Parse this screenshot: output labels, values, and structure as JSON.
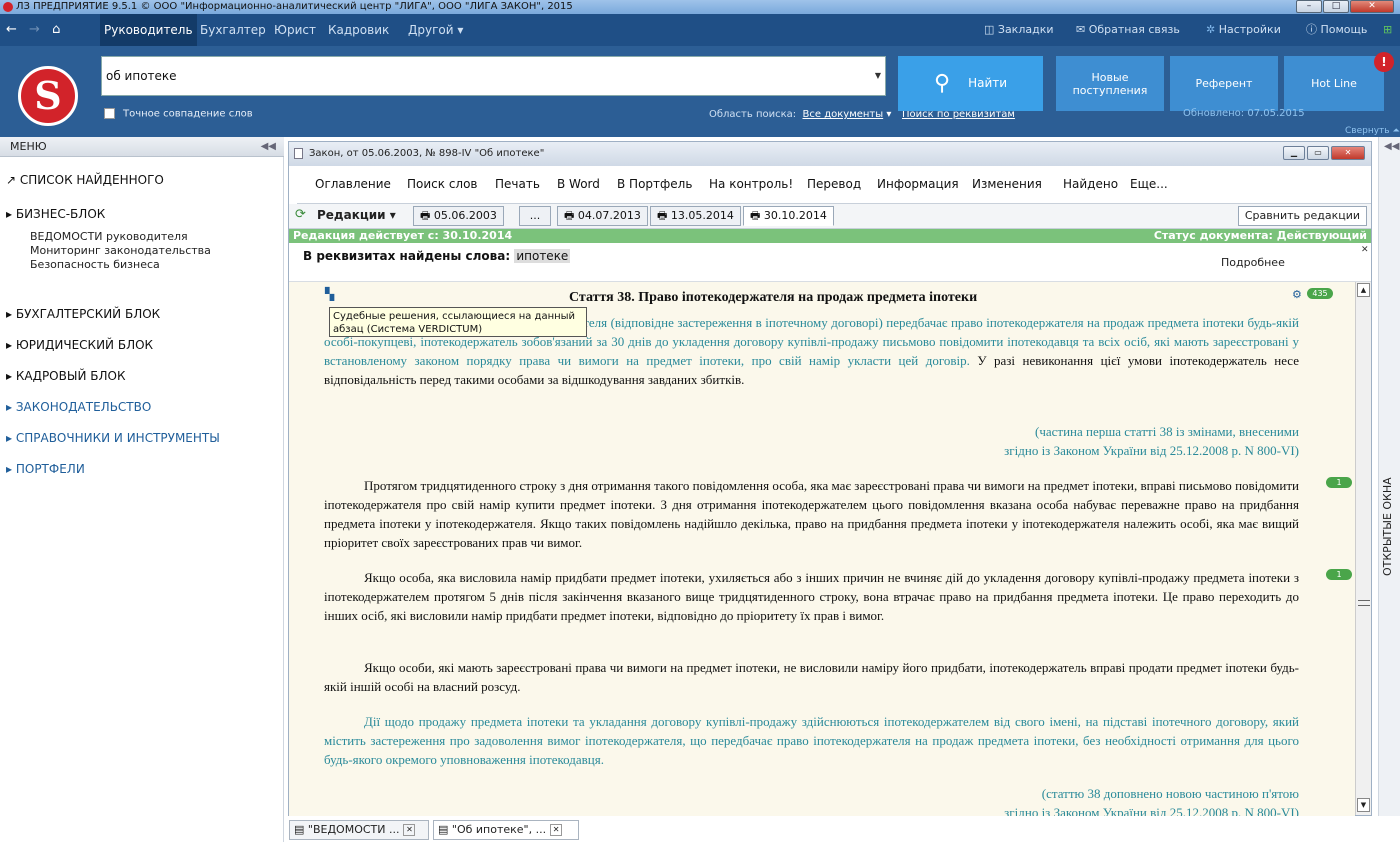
{
  "window": {
    "title": "ЛЗ ПРЕДПРИЯТИЕ 9.5.1 © ООО \"Информационно-аналитический центр \"ЛИГА\", ООО \"ЛИГА ЗАКОН\", 2015",
    "min": "–",
    "max": "□",
    "close": "✕"
  },
  "nav": {
    "back_icon": "←",
    "forward_icon": "→",
    "home_icon": "⌂",
    "tabs": [
      "Руководитель",
      "Бухгалтер",
      "Юрист",
      "Кадровик",
      "Другой ▾"
    ],
    "bookmarks": "Закладки",
    "feedback": "Обратная связь",
    "settings": "Настройки",
    "help": "Помощь"
  },
  "search": {
    "value": "об ипотеке",
    "exact_label": "Точное совпадение слов",
    "scope_label": "Область поиска:",
    "scope_value": "Все документы",
    "by_requisites": "Поиск по реквизитам",
    "find_label": "Найти"
  },
  "header": {
    "new_docs": "Новые поступления",
    "referent": "Референт",
    "hotline": "Hot Line",
    "updated": "Обновлено: 07.05.2015",
    "collapse": "Свернуть",
    "badge": "!"
  },
  "menu": {
    "title": "МЕНЮ",
    "found_list": "СПИСОК НАЙДЕННОГО",
    "business": "БИЗНЕС-БЛОК",
    "business_items": [
      "ВЕДОМОСТИ руководителя",
      "Мониторинг законодательства",
      "Безопасность бизнеса"
    ],
    "accounting": "БУХГАЛТЕРСКИЙ БЛОК",
    "legal": "ЮРИДИЧЕСКИЙ БЛОК",
    "hr": "КАДРОВЫЙ БЛОК",
    "legislation": "ЗАКОНОДАТЕЛЬСТВО",
    "references": "СПРАВОЧНИКИ И ИНСТРУМЕНТЫ",
    "portfolios": "ПОРТФЕЛИ"
  },
  "doc": {
    "title": "Закон, от 05.06.2003, № 898-IV \"Об ипотеке\"",
    "menu": [
      "Оглавление",
      "Поиск слов",
      "Печать",
      "В Word",
      "В Портфель",
      "На контроль!",
      "Перевод",
      "Информация",
      "Изменения",
      "Найдено",
      "Еще..."
    ],
    "revisions_label": "Редакции",
    "revisions": [
      "05.06.2003",
      "...",
      "04.07.2013",
      "13.05.2014",
      "30.10.2014"
    ],
    "compare": "Сравнить редакции",
    "effective": "Редакция действует с: 30.10.2014",
    "status": "Статус документа: Действующий",
    "found_words_label": "В реквизитах найдены слова:",
    "found_word": "ипотеке",
    "details": "Подробнее",
    "article_title": "Стаття 38. Право іпотекодержателя на продаж предмета іпотеки",
    "count_badge": "435",
    "tooltip": "Судебные решения, ссылающиеся на данный абзац (Система VERDICTUM)",
    "p1_teal": "У разі задоволення вимог іпотекодержателя (відповідне застереження в іпотечному договорі) передбачає право іпотекодержателя на продаж предмета іпотеки будь-якій особі-покупцеві, іпотекодержатель зобов'язаний за 30 днів до укладення договору купівлі-продажу письмово повідомити іпотекодавця та всіх осіб, які мають зареєстровані у встановленому законом порядку права чи вимоги на предмет іпотеки, про свій намір укласти цей договір.",
    "p1_black": " У разі невиконання цієї умови іпотекодержатель несе відповідальність перед такими особами за відшкодування завданих збитків.",
    "note1_a": "(частина перша статті 38 із змінами, внесеними",
    "note1_b": "згідно із Законом України від 25.12.2008 р. N 800-VI)",
    "p2": "Протягом тридцятиденного строку з дня отримання такого повідомлення особа, яка має зареєстровані права чи вимоги на предмет іпотеки, вправі письмово повідомити іпотекодержателя про свій намір купити предмет іпотеки. З дня отримання іпотекодержателем цього повідомлення вказана особа набуває переважне право на придбання предмета іпотеки у іпотекодержателя. Якщо таких повідомлень надійшло декілька, право на придбання предмета іпотеки у іпотекодержателя належить особі, яка має вищий пріоритет своїх зареєстрованих прав чи вимог.",
    "p3": "Якщо особа, яка висловила намір придбати предмет іпотеки, ухиляється або з інших причин не вчиняє дій до укладення договору купівлі-продажу предмета іпотеки з іпотекодержателем протягом 5 днів після закінчення вказаного вище тридцятиденного строку, вона втрачає право на придбання предмета іпотеки. Це право переходить до інших осіб, які висловили намір придбати предмет іпотеки, відповідно до пріоритету їх прав і вимог.",
    "p4": "Якщо особи, які мають зареєстровані права чи вимоги на предмет іпотеки, не висловили наміру його придбати, іпотекодержатель вправі продати предмет іпотеки будь-якій іншій особі на власний розсуд.",
    "p5": "Дії щодо продажу предмета іпотеки та укладання договору купівлі-продажу здійснюються іпотекодержателем від свого імені, на підставі іпотечного договору, який містить застереження про задоволення вимог іпотекодержателя, що передбачає право іпотекодержателя на продаж предмета іпотеки, без необхідності отримання для цього будь-якого окремого уповноваження іпотекодавця.",
    "note2_a": "(статтю 38 доповнено новою частиною п'ятою",
    "note2_b": "згідно із Законом України від 25.12.2008 р. N 800-VI)",
    "pill": "1"
  },
  "bottom_tabs": [
    "\"ВЕДОМОСТИ ...",
    "\"Об ипотеке\", ..."
  ],
  "right_strip": "ОТКРЫТЫЕ ОКНА",
  "colors": {
    "nav": "#1f4f86",
    "header": "#2c5e95",
    "find": "#3aa0e8",
    "status_green": "#7bc27b",
    "teal_text": "#2a8a9a",
    "logo_red": "#d2232a"
  }
}
